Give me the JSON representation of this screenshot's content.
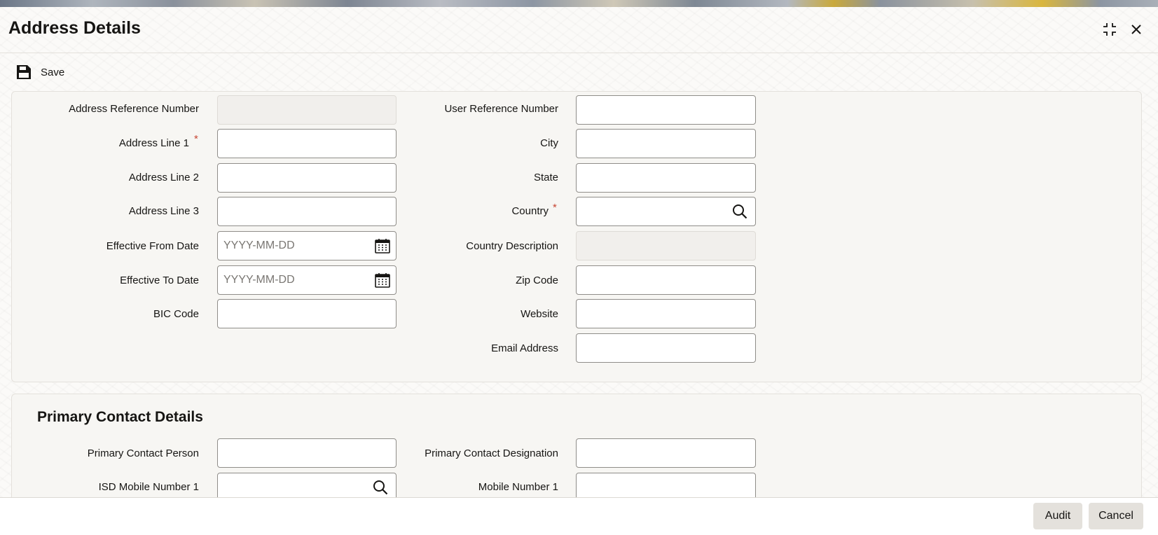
{
  "window": {
    "title": "Address Details"
  },
  "toolbar": {
    "save_label": "Save"
  },
  "address": {
    "address_reference_number": {
      "label": "Address Reference Number",
      "value": ""
    },
    "address_line_1": {
      "label": "Address Line 1",
      "required_mark": "*",
      "value": ""
    },
    "address_line_2": {
      "label": "Address Line 2",
      "value": ""
    },
    "address_line_3": {
      "label": "Address Line 3",
      "value": ""
    },
    "effective_from_date": {
      "label": "Effective From Date",
      "placeholder": "YYYY-MM-DD"
    },
    "effective_to_date": {
      "label": "Effective To Date",
      "placeholder": "YYYY-MM-DD"
    },
    "bic_code": {
      "label": "BIC Code",
      "value": ""
    },
    "user_reference_number": {
      "label": "User Reference Number",
      "value": ""
    },
    "city": {
      "label": "City",
      "value": ""
    },
    "state": {
      "label": "State",
      "value": ""
    },
    "country": {
      "label": "Country",
      "required_mark": "*",
      "value": ""
    },
    "country_description": {
      "label": "Country Description",
      "value": ""
    },
    "zip_code": {
      "label": "Zip Code",
      "value": ""
    },
    "website": {
      "label": "Website",
      "value": ""
    },
    "email_address": {
      "label": "Email Address",
      "value": ""
    }
  },
  "primary_contact": {
    "section_title": "Primary Contact Details",
    "contact_person": {
      "label": "Primary Contact Person",
      "value": ""
    },
    "contact_designation": {
      "label": "Primary Contact Designation",
      "value": ""
    },
    "isd_mobile_number_1": {
      "label": "ISD Mobile Number 1",
      "value": ""
    },
    "mobile_number_1": {
      "label": "Mobile Number 1",
      "value": ""
    }
  },
  "footer": {
    "audit_label": "Audit",
    "cancel_label": "Cancel"
  },
  "icons": {
    "save": "floppy-disk-icon",
    "maximize": "maximize-icon",
    "close": "close-icon",
    "search": "search-icon",
    "calendar": "calendar-icon"
  },
  "colors": {
    "required": "#c74634",
    "panel": "#f7f6f3",
    "button": "#e4e1dc"
  }
}
